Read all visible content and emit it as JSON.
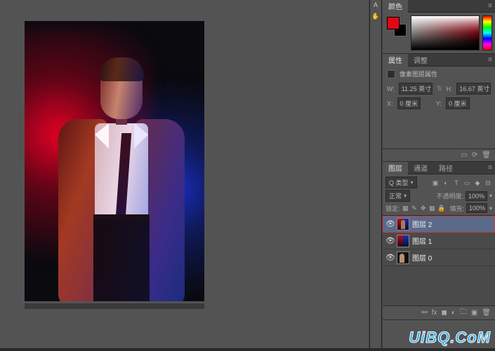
{
  "canvas": {
    "alt": "portrait-red-blue-smoke"
  },
  "color_panel": {
    "tab": "颜色",
    "foreground": "#e30613",
    "background": "#000000"
  },
  "properties_panel": {
    "tabs": {
      "properties": "属性",
      "adjust": "调整"
    },
    "title": "像素图层属性",
    "w_label": "W:",
    "w_value": "11.25 英寸",
    "h_label": "H:",
    "h_value": "16.67 英寸",
    "x_label": "X:",
    "x_value": "0 厘米",
    "y_label": "Y:",
    "y_value": "0 厘米"
  },
  "layers_panel": {
    "tabs": {
      "layers": "图层",
      "channels": "通道",
      "paths": "路径"
    },
    "kind_label": "Q 类型",
    "blend_mode": "正常",
    "opacity_label": "不透明度:",
    "opacity_value": "100%",
    "lock_label": "锁定:",
    "fill_label": "填充:",
    "fill_value": "100%",
    "layers": [
      {
        "name": "图层 2",
        "visible": true,
        "selected": true
      },
      {
        "name": "图层 1",
        "visible": true,
        "selected": false
      },
      {
        "name": "图层 0",
        "visible": true,
        "selected": false
      }
    ]
  },
  "watermark": "UiBQ.CoM"
}
